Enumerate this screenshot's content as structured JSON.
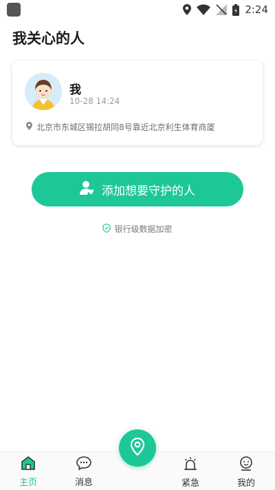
{
  "status_bar": {
    "time": "2:24",
    "icons": [
      "location-icon",
      "wifi-icon",
      "signal-off-icon",
      "battery-icon"
    ]
  },
  "page": {
    "title": "我关心的人"
  },
  "person_card": {
    "name": "我",
    "time": "10-28 14:24",
    "address": "北京市东城区锡拉胡同8号靠近北京利生体育商厦"
  },
  "add_button": {
    "label": "添加想要守护的人",
    "color": "#1ec797"
  },
  "encrypt_note": {
    "label": "银行级数据加密"
  },
  "bottom_nav": {
    "items": [
      {
        "label": "主页",
        "icon": "home-icon",
        "active": true
      },
      {
        "label": "消息",
        "icon": "message-icon",
        "active": false
      },
      {
        "label": "紧急",
        "icon": "alarm-icon",
        "active": false
      },
      {
        "label": "我的",
        "icon": "profile-icon",
        "active": false
      }
    ],
    "center_icon": "location-pin-icon",
    "accent": "#1ec797"
  }
}
